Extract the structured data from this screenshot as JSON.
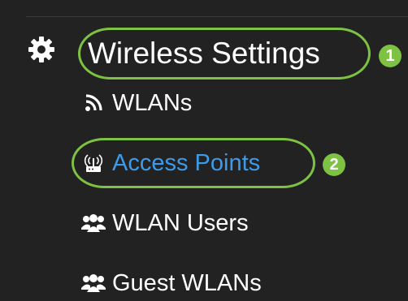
{
  "section": {
    "title": "Wireless Settings",
    "icon": "gear-icon"
  },
  "nav": {
    "items": [
      {
        "label": "WLANs",
        "icon": "wifi-icon",
        "active": false
      },
      {
        "label": "Access Points",
        "icon": "access-point-icon",
        "active": true
      },
      {
        "label": "WLAN Users",
        "icon": "users-icon",
        "active": false
      },
      {
        "label": "Guest WLANs",
        "icon": "users-icon",
        "active": false
      }
    ]
  },
  "annotations": {
    "step1": "1",
    "step2": "2",
    "highlight_color": "#7dc242"
  },
  "colors": {
    "background": "#222222",
    "text": "#ffffff",
    "active_text": "#3d9be9"
  }
}
